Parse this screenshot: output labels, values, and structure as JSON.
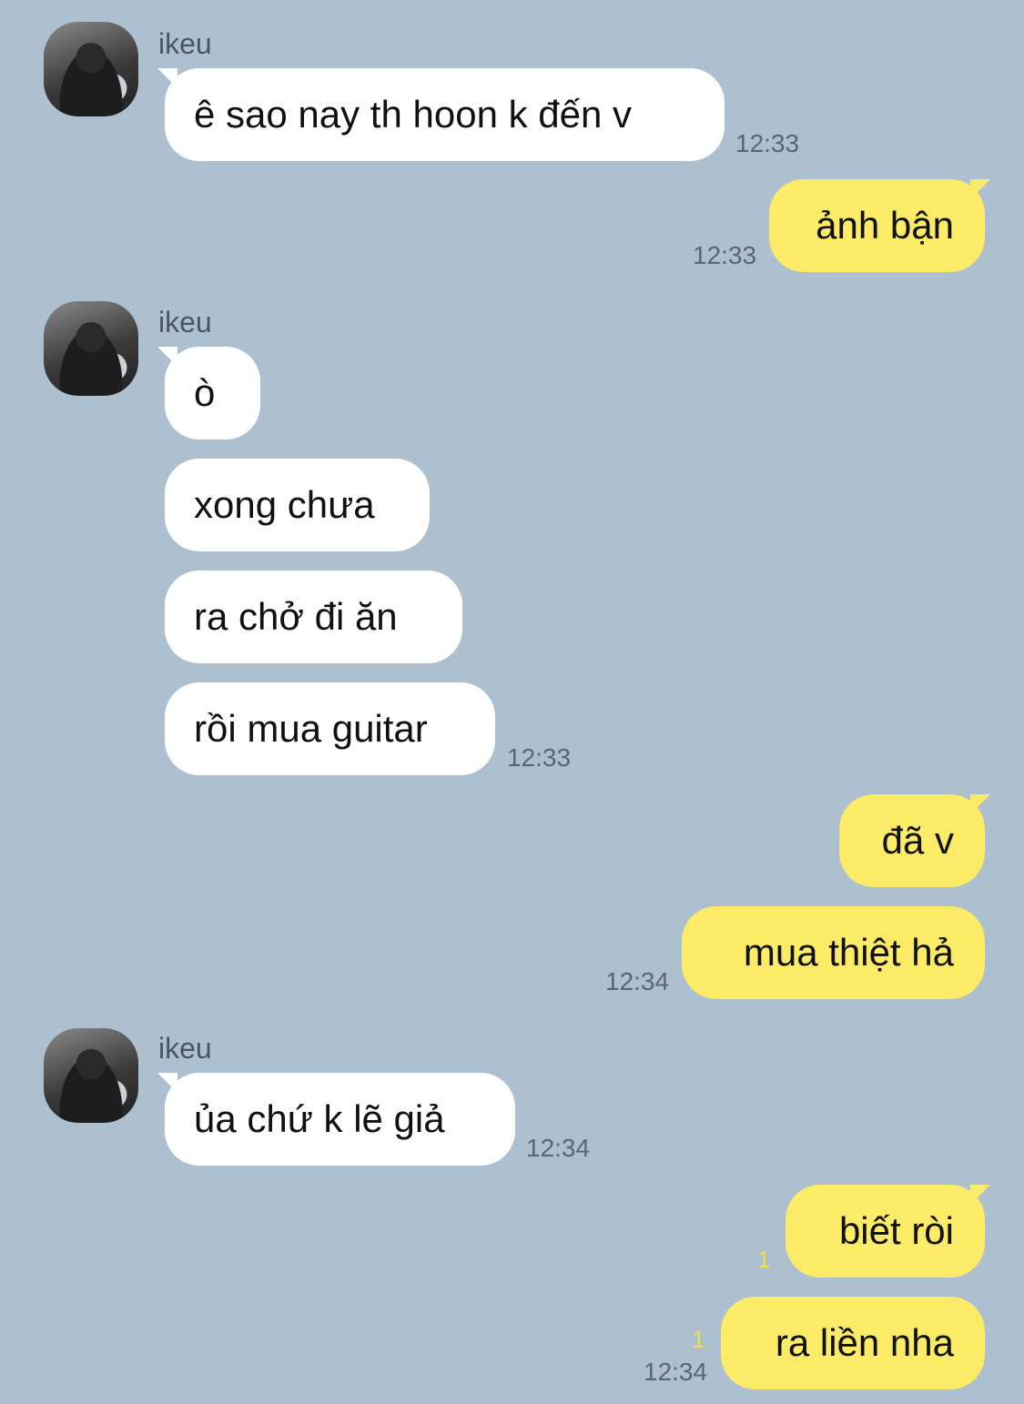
{
  "contact": {
    "name": "ikeu"
  },
  "colors": {
    "background": "#adc0d0",
    "incoming": "#ffffff",
    "outgoing": "#fbeb66",
    "unread": "#f1de4a"
  },
  "messages": [
    {
      "text": "ê sao nay th hoon k đến v",
      "time": "12:33"
    },
    {
      "text": "ảnh bận",
      "time": "12:33"
    },
    {
      "text": "ò"
    },
    {
      "text": "xong chưa"
    },
    {
      "text": "ra chở đi ăn"
    },
    {
      "text": "rồi mua guitar",
      "time": "12:33"
    },
    {
      "text": "đã v"
    },
    {
      "text": "mua thiệt hả",
      "time": "12:34"
    },
    {
      "text": "ủa chứ k lẽ giả",
      "time": "12:34"
    },
    {
      "text": "biết ròi",
      "unread": "1"
    },
    {
      "text": "ra liền nha",
      "unread": "1",
      "time": "12:34"
    }
  ]
}
